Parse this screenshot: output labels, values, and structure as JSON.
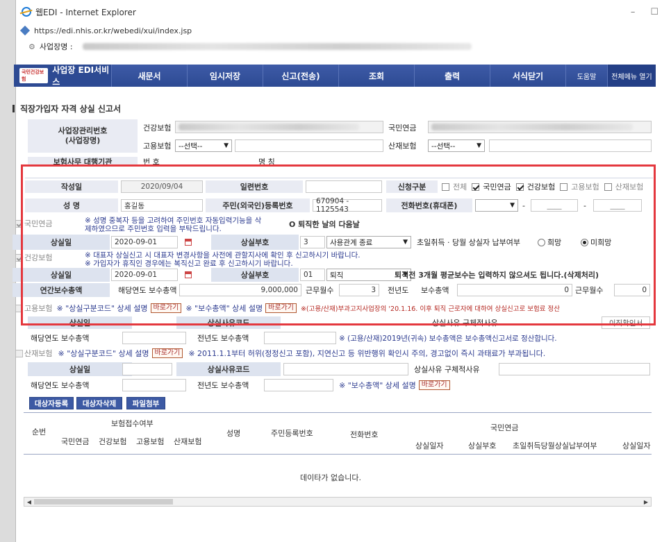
{
  "window": {
    "title": "웹EDI - Internet Explorer",
    "url": "https://edi.nhis.or.kr/webedi/xui/index.jsp",
    "biz_label": "사업장명 :"
  },
  "nav": {
    "logo_tag": "국민건강보험",
    "service": "사업장 EDI서비스",
    "items": [
      "새문서",
      "임시저장",
      "신고(전송)",
      "조회",
      "출력",
      "서식닫기"
    ],
    "help": "도움말",
    "menu": "전체메뉴 열기"
  },
  "page_title": "직장가입자 자격 상실 신고서",
  "header": {
    "biz_no_label": "사업장관리번호\n(사업장명)",
    "health": "건강보험",
    "pension": "국민연금",
    "employment": "고용보험",
    "employment_select": "--선택--",
    "industrial": "산재보험",
    "industrial_select": "--선택--",
    "agent_label": "보험사무 대행기관",
    "agent_no": "번 호",
    "agent_name": "명 칭"
  },
  "form": {
    "written_date_label": "작성일",
    "written_date": "2020/09/04",
    "serial_label": "일련번호",
    "apply_label": "신청구분",
    "apply_all": "전체",
    "apply_pension": "국민연금",
    "apply_health": "건강보험",
    "apply_employment": "고용보험",
    "apply_industrial": "산재보험",
    "name_label": "성 명",
    "name": "홍길동",
    "rrn_label": "주민(외국인)등록번호",
    "rrn": "670904 - 1125543",
    "phone_label": "전화번호(휴대폰)",
    "phone_dash1": "-",
    "phone_p2": "____",
    "phone_dash2": "-",
    "phone_p3": "____",
    "note_dup": "※ 성명 중복자 등을 고려하여 주민번호 자동입력기능을 삭제하였으므로 주민번호 입력을 부탁드립니다.",
    "note_retire": "O 퇴직한 날의 다음날"
  },
  "pension": {
    "label": "국민연금",
    "loss_date_label": "상실일",
    "loss_date": "2020-09-01",
    "loss_code_label": "상실부호",
    "loss_code_no": "3",
    "loss_code": "사용관계 종료",
    "first_label": "초일취득 · 당월 상실자 납부여부",
    "opt_yes": "희망",
    "opt_no": "미희망"
  },
  "health": {
    "label": "건강보험",
    "note1": "※ 대표자 상실신고 시 대표자 변경사항을 사전에 관할지사에 확인 후 신고하시기 바랍니다.",
    "note2": "※ 가입자가 휴직인 경우에는 복직신고 완료 후 신고하시기 바랍니다.",
    "loss_date_label": "상실일",
    "loss_date": "2020-09-01",
    "loss_code_label": "상실부호",
    "loss_code_no": "01",
    "loss_code": "퇴직",
    "retire_note": "퇴직전 3개월 평균보수는 입력하지 않으셔도 됩니다.(삭제처리)",
    "annual_label": "연간보수총액",
    "year_label": "해당연도",
    "sum_label": "보수총액",
    "sum": "9,000,000",
    "months_label": "근무월수",
    "months": "3",
    "prev_label": "전년도",
    "prev_sum_label": "보수총액",
    "prev_sum": "0",
    "prev_months_label": "근무월수",
    "prev_months": "0"
  },
  "employment": {
    "label": "고용보험",
    "code_note": "※ \"상실구분코드\" 상세 설명",
    "go1": "바로가기",
    "sum_note": "※ \"보수총액\" 상세 설명",
    "go2": "바로가기",
    "note_red": "※(고용/산재)부과고지사업장의 '20.1.16. 이후 퇴직 근로자에 대하여 상실신고로 보험료 정산",
    "loss_date_label": "상실일",
    "loss_reason_label": "상실사유코드",
    "reason_detail_label": "상실사유 구체적사유",
    "cert_btn": "이직확인서",
    "year_sum_label": "해당연도 보수총액",
    "prev_sum_label": "전년도 보수총액",
    "note2019": "※ (고용/산재)2019년(귀속) 보수총액은 보수총액신고서로 정산합니다."
  },
  "industrial": {
    "label": "산재보험",
    "code_note": "※ \"상실구분코드\" 상세 설명",
    "go1": "바로가기",
    "note2011": "※ 2011.1.1부터 허위(정정신고 포함), 지연신고 등 위반행위 확인시 주의, 경고없이 즉시 과태료가 부과됩니다.",
    "loss_date_label": "상실일",
    "loss_reason_label": "상실사유코드",
    "reason_detail_label": "상실사유 구체적사유",
    "year_sum_label": "해당연도 보수총액",
    "prev_sum_label": "전년도 보수총액",
    "sum_note": "※ \"보수총액\" 상세 설명",
    "go2": "바로가기"
  },
  "actions": {
    "add": "대상자등록",
    "delete": "대상자삭제",
    "attach": "파일첨부"
  },
  "grid": {
    "col_no": "순번",
    "reception": "보험접수여부",
    "rec_cols": [
      "국민연금",
      "건강보험",
      "고용보험",
      "산재보험"
    ],
    "name": "성명",
    "rrn": "주민등록번호",
    "phone": "전화번호",
    "pension_group": "국민연금",
    "pension_cols": [
      "상실일자",
      "상실부호",
      "초일취득당월상실납부여부",
      "상실일자"
    ],
    "empty": "데이타가 없습니다."
  }
}
